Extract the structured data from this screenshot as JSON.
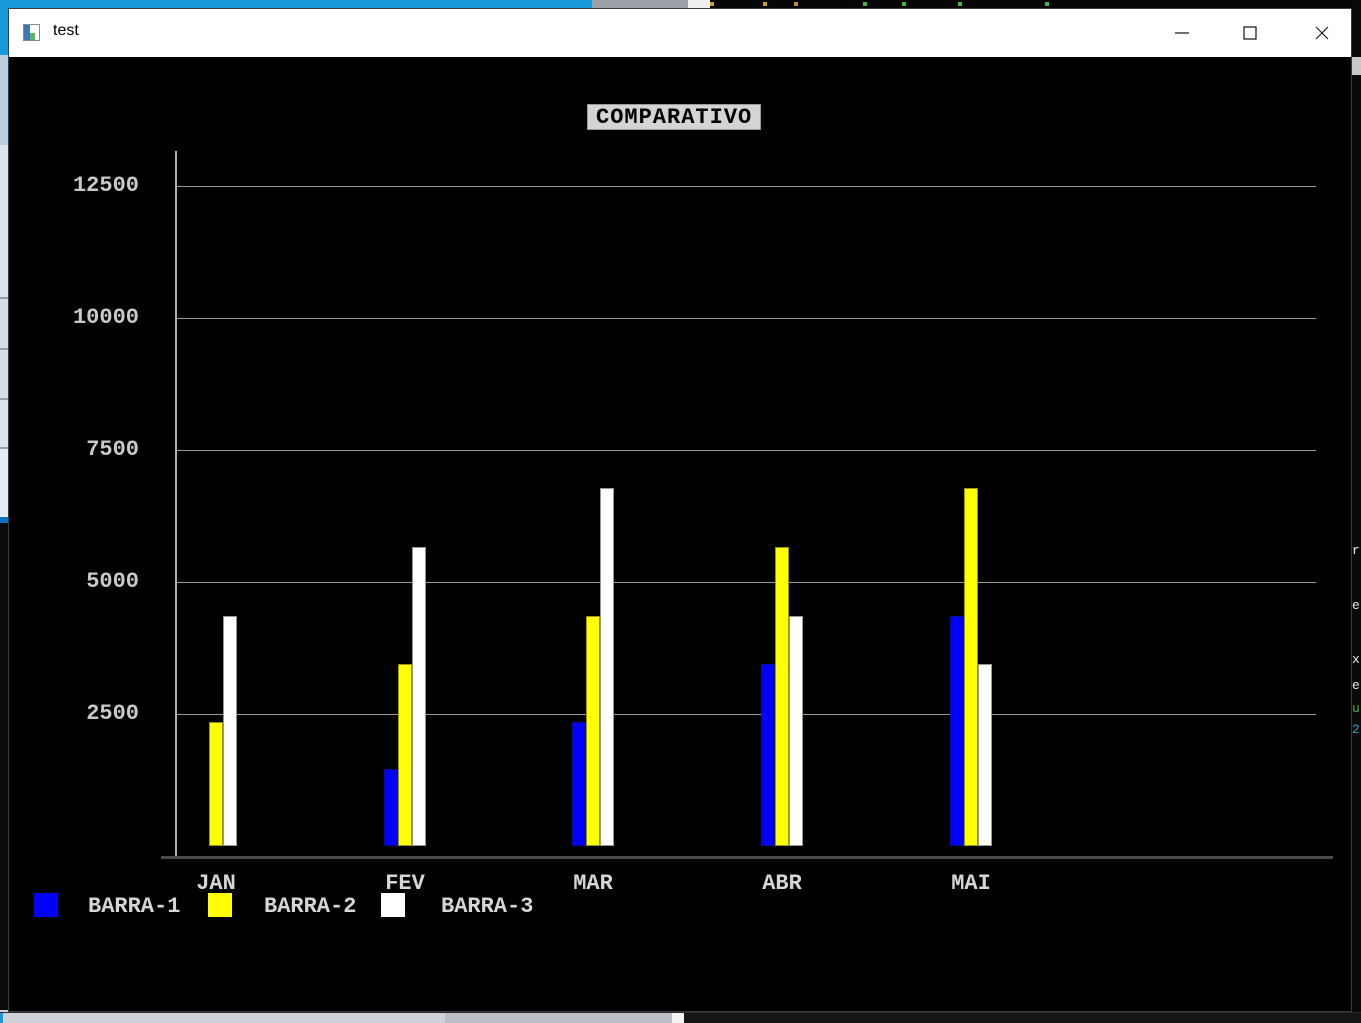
{
  "window": {
    "title": "test"
  },
  "chart_data": {
    "type": "bar",
    "title": "COMPARATIVO",
    "categories": [
      "JAN",
      "FEV",
      "MAR",
      "ABR",
      "MAI"
    ],
    "series": [
      {
        "name": "BARRA-1",
        "color": "#0000ff",
        "values": [
          0,
          1450,
          2345,
          3455,
          4350
        ]
      },
      {
        "name": "BARRA-2",
        "color": "#ffff00",
        "values": [
          2345,
          3455,
          4350,
          5670,
          6780
        ]
      },
      {
        "name": "BARRA-3",
        "color": "#ffffff",
        "values": [
          4350,
          5670,
          6780,
          4350,
          3455
        ]
      }
    ],
    "yticks": [
      2500,
      5000,
      7500,
      10000,
      12500
    ],
    "ylim": [
      0,
      13100
    ],
    "grid": true,
    "legend_position": "bottom-left",
    "colors": {
      "plot_background": "#000000",
      "gridline": "#9b9b9b",
      "axis": "#4a4a4a",
      "tick_text": "#c9c9c9",
      "title_box_background": "#d4d4d4",
      "title_text": "#000000"
    }
  },
  "background_fragments": {
    "right_edge_chars": [
      {
        "char": "r",
        "color": "#e8e8e8"
      },
      {
        "char": "e",
        "color": "#e8e8e8"
      },
      {
        "char": "x",
        "color": "#e8e8e8"
      },
      {
        "char": "e",
        "color": "#e8e8e8"
      },
      {
        "char": "u",
        "color": "#3fb54a"
      },
      {
        "char": "2",
        "color": "#2a9fc4"
      }
    ]
  }
}
